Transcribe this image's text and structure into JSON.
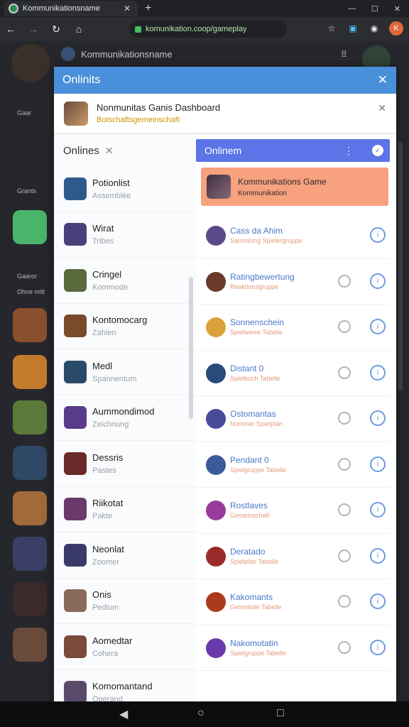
{
  "browser": {
    "tab_title": "Kommunikationsname",
    "url": "komunikation.coop/gameplay",
    "profile_initial": "K"
  },
  "background_app": {
    "header_title": "Kommunikationsname",
    "rail_labels": [
      "Gaar",
      "Grants",
      "Gaaror",
      "Ohne mitt"
    ]
  },
  "dialog": {
    "title": "Onlinits",
    "server_name": "Nonmunitas Ganis Dashboard",
    "server_sub": "Botschaftsgemeinschaft",
    "left_filter_label": "Onlines",
    "right_header_label": "Onlinem",
    "featured": {
      "name": "Kommunikations Game",
      "sub": "Kommunikation"
    },
    "members": [
      {
        "name": "Potionlist",
        "status": "Assemblée"
      },
      {
        "name": "Wirat",
        "status": "Tribes"
      },
      {
        "name": "Cringel",
        "status": "Kommode"
      },
      {
        "name": "Kontomocarg",
        "status": "Zahlen"
      },
      {
        "name": "Medl",
        "status": "Spannentum"
      },
      {
        "name": "Aummondimod",
        "status": "Zeichnung"
      },
      {
        "name": "Dessris",
        "status": "Pastes"
      },
      {
        "name": "Riikotat",
        "status": "Pakte"
      },
      {
        "name": "Neonlat",
        "status": "Zoomer"
      },
      {
        "name": "Onis",
        "status": "Pedium"
      },
      {
        "name": "Aomedtar",
        "status": "Cohera"
      },
      {
        "name": "Komomantand",
        "status": "Operand"
      }
    ],
    "rows": [
      {
        "name": "Cass da Ahim",
        "sub": "Sammlung Spielergruppe"
      },
      {
        "name": "Ratingbewertung",
        "sub": "Reaktionsgruppe"
      },
      {
        "name": "Sonnenschein",
        "sub": "Spielwiese Tabelle"
      },
      {
        "name": "Distant 0",
        "sub": "Spielbuch Tabelle"
      },
      {
        "name": "Ostomantas",
        "sub": "Nummer Spielplan"
      },
      {
        "name": "Pendant 0",
        "sub": "Spielgruppe Tabelle"
      },
      {
        "name": "Rostlaves",
        "sub": "Gemeinschaft"
      },
      {
        "name": "Deratado",
        "sub": "Spielplan Tabelle"
      },
      {
        "name": "Kakomants",
        "sub": "Gemeinde Tabelle"
      },
      {
        "name": "Nakomotatin",
        "sub": "Spielgruppe Tabelle"
      }
    ],
    "info_glyph": "i"
  },
  "colors": {
    "dialog_header": "#4a8fd9",
    "right_header": "#5b74e8",
    "featured_bg": "#f7a17f",
    "link_blue": "#4a78c8"
  }
}
